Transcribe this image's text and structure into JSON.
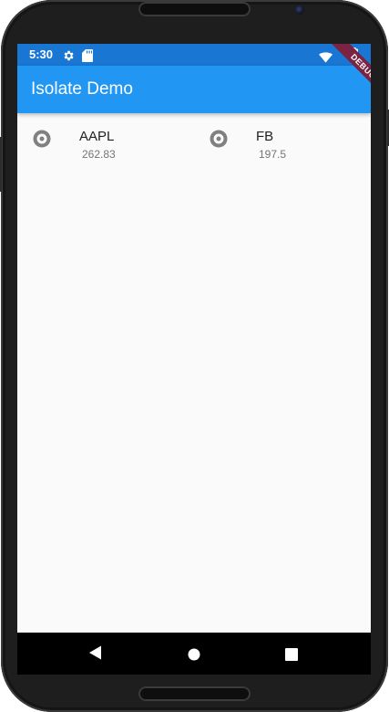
{
  "status_bar": {
    "time": "5:30",
    "background_color": "#1976d2",
    "icons": [
      "gear-icon",
      "sd-card-icon",
      "wifi-icon",
      "battery-icon"
    ]
  },
  "app_bar": {
    "title": "Isolate Demo",
    "background_color": "#2196f3"
  },
  "debug_banner": {
    "label": "DEBUG"
  },
  "stocks": [
    {
      "symbol": "AAPL",
      "price": "262.83",
      "icon": "radio-disc-icon"
    },
    {
      "symbol": "FB",
      "price": "197.5",
      "icon": "radio-disc-icon"
    }
  ],
  "navigation_bar": {
    "buttons": [
      "back-icon",
      "home-icon",
      "recents-icon"
    ]
  }
}
